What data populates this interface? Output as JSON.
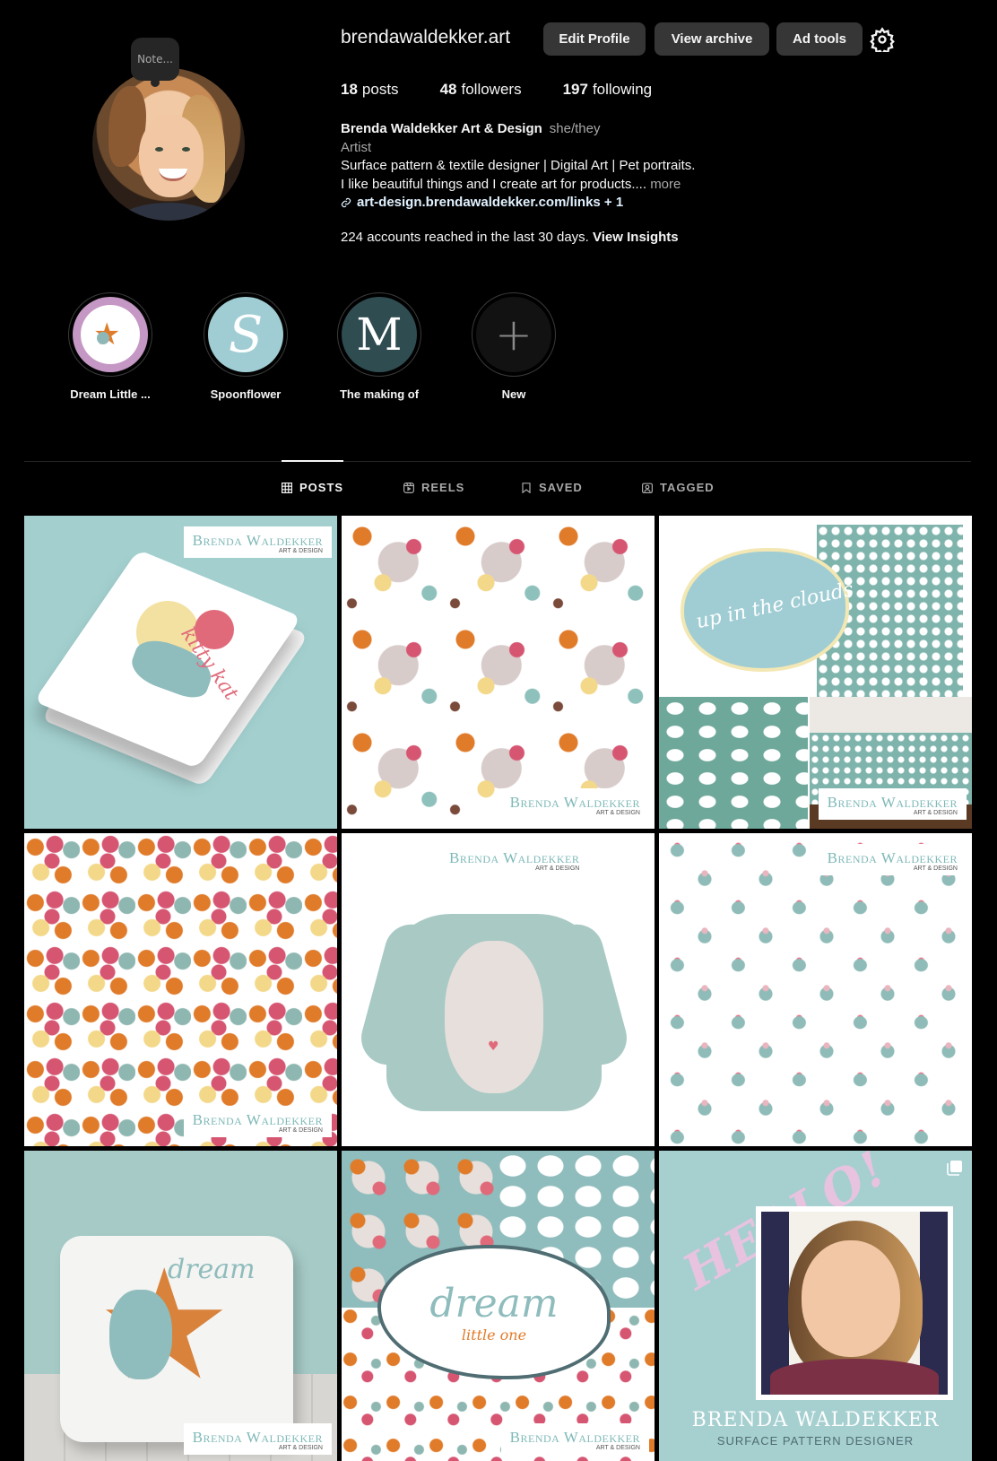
{
  "profile": {
    "note": "Note...",
    "username": "brendawaldekker.art",
    "buttons": {
      "edit": "Edit Profile",
      "archive": "View archive",
      "adtools": "Ad tools"
    },
    "stats": {
      "posts_count": "18",
      "posts_label": "posts",
      "followers_count": "48",
      "followers_label": "followers",
      "following_count": "197",
      "following_label": "following"
    },
    "bio": {
      "name": "Brenda Waldekker Art & Design",
      "pronouns": "she/they",
      "category": "Artist",
      "line1": "Surface pattern & textile designer | Digital Art | Pet portraits.",
      "line2": "I like beautiful things and I create art for products....",
      "more": "more",
      "link": "art-design.brendawaldekker.com/links + 1",
      "insights_text": "224 accounts reached in the last 30 days.",
      "insights_link": "View Insights"
    }
  },
  "highlights": [
    {
      "label": "Dream Little ..."
    },
    {
      "label": "Spoonflower",
      "glyph": "S"
    },
    {
      "label": "The making of",
      "glyph": "M"
    },
    {
      "label": "New",
      "glyph": "+"
    }
  ],
  "tabs": [
    {
      "label": "POSTS",
      "icon": "grid-icon",
      "active": true
    },
    {
      "label": "REELS",
      "icon": "reels-icon"
    },
    {
      "label": "SAVED",
      "icon": "bookmark-icon"
    },
    {
      "label": "TAGGED",
      "icon": "tagged-icon"
    }
  ],
  "posts": [
    {
      "brand": "Brenda Waldekker",
      "brand_sub": "ART & DESIGN",
      "art_text": "kitty kat"
    },
    {
      "brand": "Brenda Waldekker",
      "brand_sub": "ART & DESIGN"
    },
    {
      "brand": "Brenda Waldekker",
      "brand_sub": "ART & DESIGN",
      "art_text": "up in the clouds"
    },
    {
      "brand": "Brenda Waldekker",
      "brand_sub": "ART & DESIGN"
    },
    {
      "brand": "Brenda Waldekker",
      "brand_sub": "ART & DESIGN"
    },
    {
      "brand": "Brenda Waldekker",
      "brand_sub": "ART & DESIGN"
    },
    {
      "brand": "Brenda Waldekker",
      "brand_sub": "ART & DESIGN",
      "art_text": "dream"
    },
    {
      "brand": "Brenda Waldekker",
      "brand_sub": "ART & DESIGN",
      "art_text": "dream",
      "art_text2": "little one"
    },
    {
      "art_text": "HELLO!",
      "name1": "BRENDA WALDEKKER",
      "name2": "SURFACE PATTERN DESIGNER"
    }
  ],
  "colors": {
    "background": "#000000",
    "button": "#363636",
    "text_primary": "#f5f5f5",
    "text_secondary": "#a8a8a8",
    "link": "#e0f1ff"
  }
}
